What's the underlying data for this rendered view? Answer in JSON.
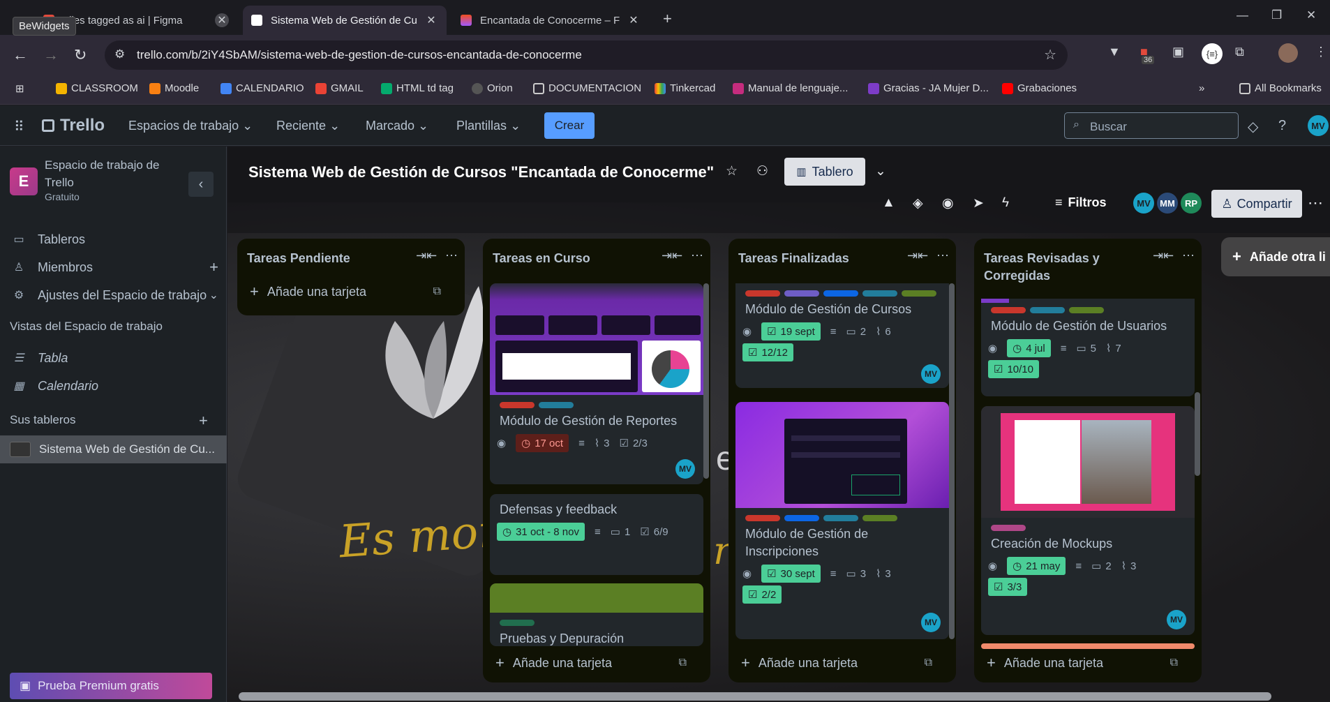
{
  "browser": {
    "tooltip": "BeWidgets",
    "tabs": [
      {
        "title": "Files tagged as ai | Figma"
      },
      {
        "title": "Sistema Web de Gestión de Cu"
      },
      {
        "title": "Encantada de Conocerme – Figi"
      }
    ],
    "url": "trello.com/b/2iY4SbAM/sistema-web-de-gestion-de-cursos-encantada-de-conocerme",
    "extension_badge": "36",
    "bookmarks": [
      "CLASSROOM",
      "Moodle",
      "CALENDARIO",
      "GMAIL",
      "HTML td tag",
      "Orion",
      "DOCUMENTACION",
      "Tinkercad",
      "Manual de lenguaje...",
      "Gracias - JA Mujer D...",
      "Grabaciones"
    ],
    "all_bookmarks": "All Bookmarks"
  },
  "trello": {
    "logo": "Trello",
    "nav": [
      "Espacios de trabajo",
      "Reciente",
      "Marcado",
      "Plantillas"
    ],
    "create": "Crear",
    "search_placeholder": "Buscar",
    "user_initials": "MV"
  },
  "sidebar": {
    "workspace_initial": "E",
    "workspace_name": "Espacio de trabajo de Trello",
    "workspace_plan": "Gratuito",
    "items": [
      "Tableros",
      "Miembros",
      "Ajustes del Espacio de trabajo"
    ],
    "views_heading": "Vistas del Espacio de trabajo",
    "views": [
      "Tabla",
      "Calendario"
    ],
    "boards_heading": "Sus tableros",
    "board_name": "Sistema Web de Gestión de Cu...",
    "premium": "Prueba Premium gratis"
  },
  "board": {
    "title": "Sistema Web de Gestión de Cursos \"Encantada de Conocerme\"",
    "view": "Tablero",
    "filters": "Filtros",
    "members": [
      "MV",
      "MM",
      "RP"
    ],
    "share": "Compartir",
    "add_list": "Añade otra li",
    "background_text": "Es mome",
    "add_card": "Añade una tarjeta"
  },
  "lists": [
    {
      "title": "Tareas Pendiente",
      "cards": []
    },
    {
      "title": "Tareas en Curso",
      "cards": [
        {
          "title": "Módulo de Gestión de Reportes",
          "due": "17 oct",
          "attachments": "3",
          "checklist": "2/3",
          "member": "MV",
          "labels": [
            "#c9372c",
            "#227d9b"
          ]
        },
        {
          "title": "Defensas y feedback",
          "due": "31 oct - 8 nov",
          "comments": "1",
          "checklist": "6/9"
        },
        {
          "title": "Pruebas y Depuración",
          "labels": [
            "#216e4e"
          ],
          "cover": "#5b7f24"
        }
      ]
    },
    {
      "title": "Tareas Finalizadas",
      "cards": [
        {
          "title": "Módulo de Gestión de Cursos",
          "due": "19 sept",
          "comments": "2",
          "attachments": "6",
          "checklist": "12/12",
          "member": "MV",
          "labels": [
            "#c9372c",
            "#6e5dc6",
            "#0c66e4",
            "#227d9b",
            "#5b7f24"
          ]
        },
        {
          "title": "Módulo de Gestión de Inscripciones",
          "due": "30 sept",
          "comments": "3",
          "attachments": "3",
          "checklist": "2/2",
          "member": "MV",
          "labels": [
            "#c9372c",
            "#0c66e4",
            "#227d9b",
            "#5b7f24"
          ]
        }
      ]
    },
    {
      "title": "Tareas Revisadas y Corregidas",
      "cards": [
        {
          "title": "Módulo de Gestión de Usuarios",
          "due": "4 jul",
          "comments": "5",
          "attachments": "7",
          "checklist": "10/10",
          "labels": [
            "#c9372c",
            "#227d9b",
            "#5b7f24"
          ]
        },
        {
          "title": "Creación de Mockups",
          "due": "21 may",
          "comments": "2",
          "attachments": "3",
          "checklist": "3/3",
          "member": "MV",
          "labels": [
            "#ae4787"
          ]
        }
      ]
    }
  ],
  "colors": {
    "accent": "#579dff",
    "list_bg": "#101204",
    "card_bg": "#22272b",
    "due_green": "#4bce97",
    "overdue_red": "#5d1f1a"
  }
}
